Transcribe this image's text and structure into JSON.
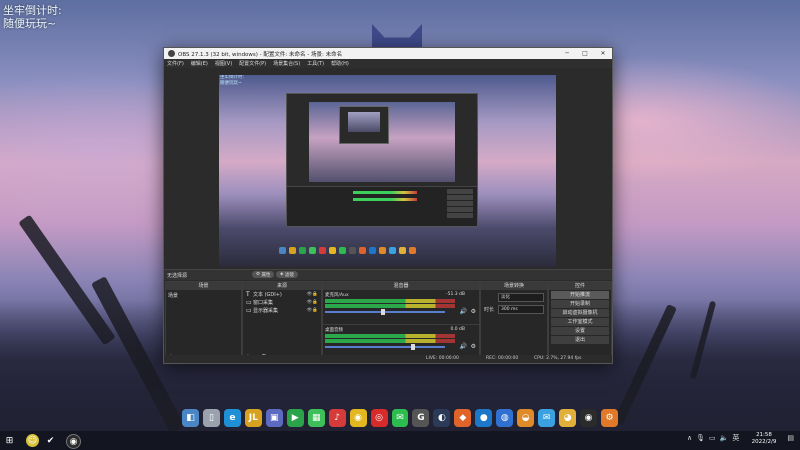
{
  "desktop": {
    "clock_title": "坐牢倒计时:",
    "clock_subtitle": "随便玩玩~"
  },
  "obs": {
    "title": "OBS 27.1.3 (32 bit, windows) - 配置文件: 未命名 - 场景: 未命名",
    "menu": [
      "文件(F)",
      "编辑(E)",
      "视图(V)",
      "配置文件(P)",
      "场景集合(S)",
      "工具(T)",
      "帮助(H)"
    ],
    "preview_text": [
      "坐牢倒计时:",
      "随便玩玩~"
    ],
    "dock_label": "无选择源",
    "dock_buttons": [
      "属性",
      "滤镜"
    ],
    "panels": {
      "scenes": "场景",
      "sources": "来源",
      "mixer": "混音器",
      "transitions": "场景转换",
      "controls": "控件"
    },
    "scenes": [
      "场景"
    ],
    "sources": [
      {
        "icon": "T",
        "name": "文本 (GDI+)"
      },
      {
        "icon": "▭",
        "name": "窗口采集"
      },
      {
        "icon": "▭",
        "name": "显示器采集"
      }
    ],
    "mixer": [
      {
        "name": "麦克风/Aux",
        "db": "-51.3 dB"
      },
      {
        "name": "桌面音频",
        "db": "0.0 dB"
      }
    ],
    "transition": {
      "type_label": "",
      "type_value": "淡化",
      "duration_label": "时长",
      "duration_value": "300 ms"
    },
    "controls": [
      "开始推流",
      "开始录制",
      "启动虚拟摄像机",
      "工作室模式",
      "设置",
      "退出"
    ],
    "status": {
      "live": "LIVE: 00:00:00",
      "rec": "REC: 00:00:00",
      "cpu": "CPU: 2.7%, 27.94 fps"
    }
  },
  "taskbar": {
    "time": "21:58",
    "date": "2022/2/9"
  },
  "dock_icons": [
    {
      "name": "finder-icon",
      "color": "#4a86c6",
      "glyph": "◧"
    },
    {
      "name": "trash-icon",
      "color": "#9aa3ad",
      "glyph": "▯"
    },
    {
      "name": "edge-icon",
      "color": "#1f8fd6",
      "glyph": "e"
    },
    {
      "name": "intellij-icon",
      "color": "#d6a21f",
      "glyph": "JL"
    },
    {
      "name": "pycharm-icon",
      "color": "#5c6bc0",
      "glyph": "▣"
    },
    {
      "name": "play-icon",
      "color": "#2aa34a",
      "glyph": "▶"
    },
    {
      "name": "chart-icon",
      "color": "#3dbf59",
      "glyph": "▦"
    },
    {
      "name": "music-icon",
      "color": "#d63b3b",
      "glyph": "♪"
    },
    {
      "name": "chrome-icon",
      "color": "#e2b71f",
      "glyph": "◉"
    },
    {
      "name": "netease-icon",
      "color": "#d62b2b",
      "glyph": "◎"
    },
    {
      "name": "wechat-icon",
      "color": "#2dbd4f",
      "glyph": "✉"
    },
    {
      "name": "clock-icon",
      "color": "#555",
      "glyph": "G"
    },
    {
      "name": "steam-icon",
      "color": "#2a3a57",
      "glyph": "◐"
    },
    {
      "name": "fox-icon",
      "color": "#e0642a",
      "glyph": "◆"
    },
    {
      "name": "record-icon",
      "color": "#1d77c9",
      "glyph": "●"
    },
    {
      "name": "browser-icon",
      "color": "#3070d0",
      "glyph": "◍"
    },
    {
      "name": "planet-icon",
      "color": "#e08a2a",
      "glyph": "◒"
    },
    {
      "name": "mail-icon",
      "color": "#3aa2e0",
      "glyph": "✉"
    },
    {
      "name": "owl-icon",
      "color": "#e0b03a",
      "glyph": "◕"
    },
    {
      "name": "obs-icon",
      "color": "#2b2b2b",
      "glyph": "◉"
    },
    {
      "name": "settings-icon",
      "color": "#e07a2a",
      "glyph": "⚙"
    }
  ]
}
